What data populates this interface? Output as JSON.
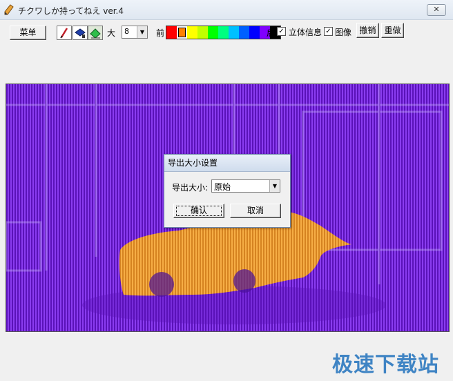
{
  "window": {
    "title": "チクワしか持ってねえ ver.4",
    "close_label": "✕"
  },
  "toolbar": {
    "menu_label": "菜单",
    "size_label": "大",
    "size_value": "8",
    "fg_label": "前",
    "bg_label": "后",
    "stereo_label": "立体信息",
    "image_label": "图像",
    "undo_label": "撤销",
    "redo_label": "重做",
    "palette": [
      "#ff0000",
      "#ff8000",
      "#ffff00",
      "#c0ff00",
      "#00ff00",
      "#00ff80",
      "#00c0ff",
      "#0060ff",
      "#0000ff",
      "#8000ff",
      "#000000"
    ],
    "selected_swatch": 1,
    "stereo_checked": true,
    "image_checked": true
  },
  "dialog": {
    "title": "导出大小设置",
    "size_label": "导出大小:",
    "size_value": "原始",
    "ok_label": "确认",
    "cancel_label": "取消"
  },
  "watermark": "极速下载站"
}
